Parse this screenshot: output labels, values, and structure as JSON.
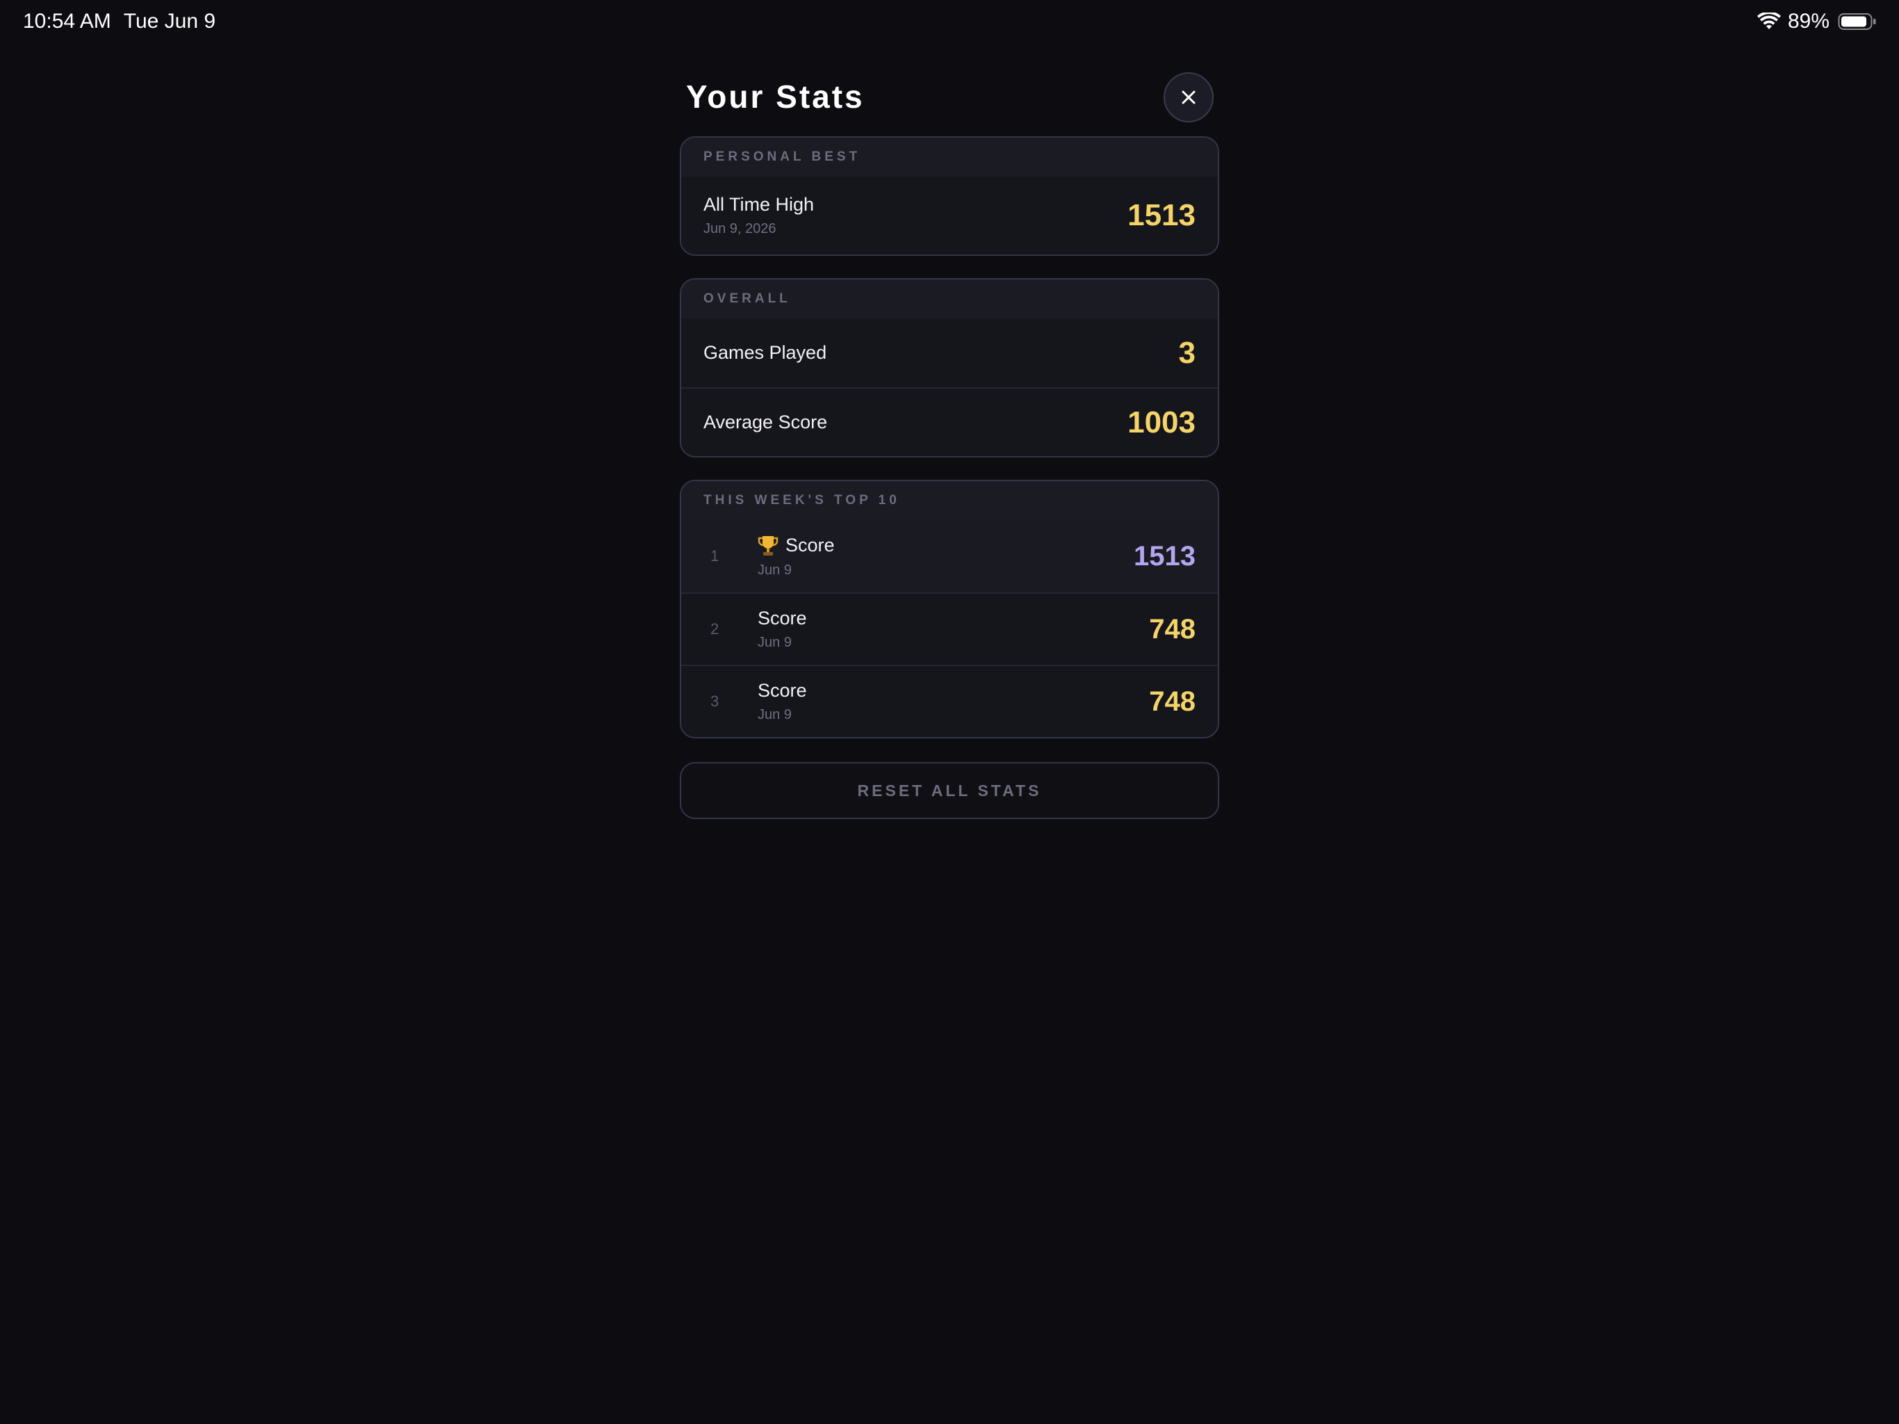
{
  "status_bar": {
    "time": "10:54 AM",
    "date": "Tue Jun 9",
    "battery_percent": "89%",
    "battery_level": 0.89,
    "icons": [
      "wifi-icon",
      "battery-icon"
    ]
  },
  "header": {
    "title": "Your Stats",
    "close_icon": "close-icon"
  },
  "personal_best": {
    "section_title": "PERSONAL BEST",
    "label": "All Time High",
    "date": "Jun 9, 2026",
    "value": "1513"
  },
  "overall": {
    "section_title": "OVERALL",
    "rows": [
      {
        "label": "Games Played",
        "value": "3"
      },
      {
        "label": "Average Score",
        "value": "1003"
      }
    ]
  },
  "top10": {
    "section_title": "THIS WEEK'S TOP 10",
    "entries": [
      {
        "rank": "1",
        "label": "Score",
        "date": "Jun 9",
        "value": "1513",
        "icon": "trophy-icon"
      },
      {
        "rank": "2",
        "label": "Score",
        "date": "Jun 9",
        "value": "748"
      },
      {
        "rank": "3",
        "label": "Score",
        "date": "Jun 9",
        "value": "748"
      }
    ]
  },
  "reset_button": {
    "label": "RESET ALL STATS"
  },
  "colors": {
    "background": "#0d0d11",
    "gold": "#f4d369",
    "purple": "#b3a6ee",
    "muted": "#6c6c7e"
  }
}
